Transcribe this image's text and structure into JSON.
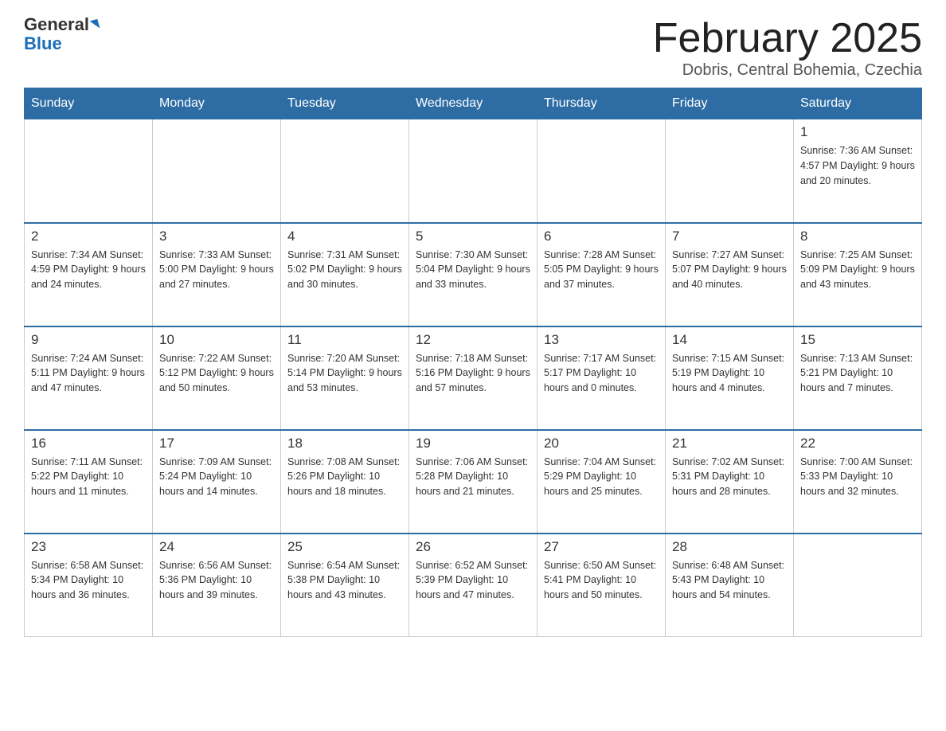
{
  "header": {
    "logo_general": "General",
    "logo_blue": "Blue",
    "month_title": "February 2025",
    "location": "Dobris, Central Bohemia, Czechia"
  },
  "days_of_week": [
    "Sunday",
    "Monday",
    "Tuesday",
    "Wednesday",
    "Thursday",
    "Friday",
    "Saturday"
  ],
  "weeks": [
    [
      {
        "day": "",
        "info": ""
      },
      {
        "day": "",
        "info": ""
      },
      {
        "day": "",
        "info": ""
      },
      {
        "day": "",
        "info": ""
      },
      {
        "day": "",
        "info": ""
      },
      {
        "day": "",
        "info": ""
      },
      {
        "day": "1",
        "info": "Sunrise: 7:36 AM\nSunset: 4:57 PM\nDaylight: 9 hours and 20 minutes."
      }
    ],
    [
      {
        "day": "2",
        "info": "Sunrise: 7:34 AM\nSunset: 4:59 PM\nDaylight: 9 hours and 24 minutes."
      },
      {
        "day": "3",
        "info": "Sunrise: 7:33 AM\nSunset: 5:00 PM\nDaylight: 9 hours and 27 minutes."
      },
      {
        "day": "4",
        "info": "Sunrise: 7:31 AM\nSunset: 5:02 PM\nDaylight: 9 hours and 30 minutes."
      },
      {
        "day": "5",
        "info": "Sunrise: 7:30 AM\nSunset: 5:04 PM\nDaylight: 9 hours and 33 minutes."
      },
      {
        "day": "6",
        "info": "Sunrise: 7:28 AM\nSunset: 5:05 PM\nDaylight: 9 hours and 37 minutes."
      },
      {
        "day": "7",
        "info": "Sunrise: 7:27 AM\nSunset: 5:07 PM\nDaylight: 9 hours and 40 minutes."
      },
      {
        "day": "8",
        "info": "Sunrise: 7:25 AM\nSunset: 5:09 PM\nDaylight: 9 hours and 43 minutes."
      }
    ],
    [
      {
        "day": "9",
        "info": "Sunrise: 7:24 AM\nSunset: 5:11 PM\nDaylight: 9 hours and 47 minutes."
      },
      {
        "day": "10",
        "info": "Sunrise: 7:22 AM\nSunset: 5:12 PM\nDaylight: 9 hours and 50 minutes."
      },
      {
        "day": "11",
        "info": "Sunrise: 7:20 AM\nSunset: 5:14 PM\nDaylight: 9 hours and 53 minutes."
      },
      {
        "day": "12",
        "info": "Sunrise: 7:18 AM\nSunset: 5:16 PM\nDaylight: 9 hours and 57 minutes."
      },
      {
        "day": "13",
        "info": "Sunrise: 7:17 AM\nSunset: 5:17 PM\nDaylight: 10 hours and 0 minutes."
      },
      {
        "day": "14",
        "info": "Sunrise: 7:15 AM\nSunset: 5:19 PM\nDaylight: 10 hours and 4 minutes."
      },
      {
        "day": "15",
        "info": "Sunrise: 7:13 AM\nSunset: 5:21 PM\nDaylight: 10 hours and 7 minutes."
      }
    ],
    [
      {
        "day": "16",
        "info": "Sunrise: 7:11 AM\nSunset: 5:22 PM\nDaylight: 10 hours and 11 minutes."
      },
      {
        "day": "17",
        "info": "Sunrise: 7:09 AM\nSunset: 5:24 PM\nDaylight: 10 hours and 14 minutes."
      },
      {
        "day": "18",
        "info": "Sunrise: 7:08 AM\nSunset: 5:26 PM\nDaylight: 10 hours and 18 minutes."
      },
      {
        "day": "19",
        "info": "Sunrise: 7:06 AM\nSunset: 5:28 PM\nDaylight: 10 hours and 21 minutes."
      },
      {
        "day": "20",
        "info": "Sunrise: 7:04 AM\nSunset: 5:29 PM\nDaylight: 10 hours and 25 minutes."
      },
      {
        "day": "21",
        "info": "Sunrise: 7:02 AM\nSunset: 5:31 PM\nDaylight: 10 hours and 28 minutes."
      },
      {
        "day": "22",
        "info": "Sunrise: 7:00 AM\nSunset: 5:33 PM\nDaylight: 10 hours and 32 minutes."
      }
    ],
    [
      {
        "day": "23",
        "info": "Sunrise: 6:58 AM\nSunset: 5:34 PM\nDaylight: 10 hours and 36 minutes."
      },
      {
        "day": "24",
        "info": "Sunrise: 6:56 AM\nSunset: 5:36 PM\nDaylight: 10 hours and 39 minutes."
      },
      {
        "day": "25",
        "info": "Sunrise: 6:54 AM\nSunset: 5:38 PM\nDaylight: 10 hours and 43 minutes."
      },
      {
        "day": "26",
        "info": "Sunrise: 6:52 AM\nSunset: 5:39 PM\nDaylight: 10 hours and 47 minutes."
      },
      {
        "day": "27",
        "info": "Sunrise: 6:50 AM\nSunset: 5:41 PM\nDaylight: 10 hours and 50 minutes."
      },
      {
        "day": "28",
        "info": "Sunrise: 6:48 AM\nSunset: 5:43 PM\nDaylight: 10 hours and 54 minutes."
      },
      {
        "day": "",
        "info": ""
      }
    ]
  ]
}
